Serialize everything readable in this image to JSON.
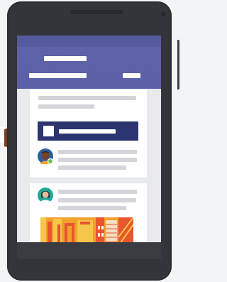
{
  "colors": {
    "phone_body": "#33353a",
    "header_purple": "#5e62a8",
    "banner_navy": "#2c3570",
    "placeholder_gray": "#d3d5da",
    "status_green": "#6bbf4e",
    "photo_orange": "#f2a12a"
  },
  "icons": {
    "avatar_one": "person-avatar-icon",
    "avatar_two": "person-avatar-icon",
    "status": "online-status-icon",
    "hand": "pointing-hand-icon"
  }
}
